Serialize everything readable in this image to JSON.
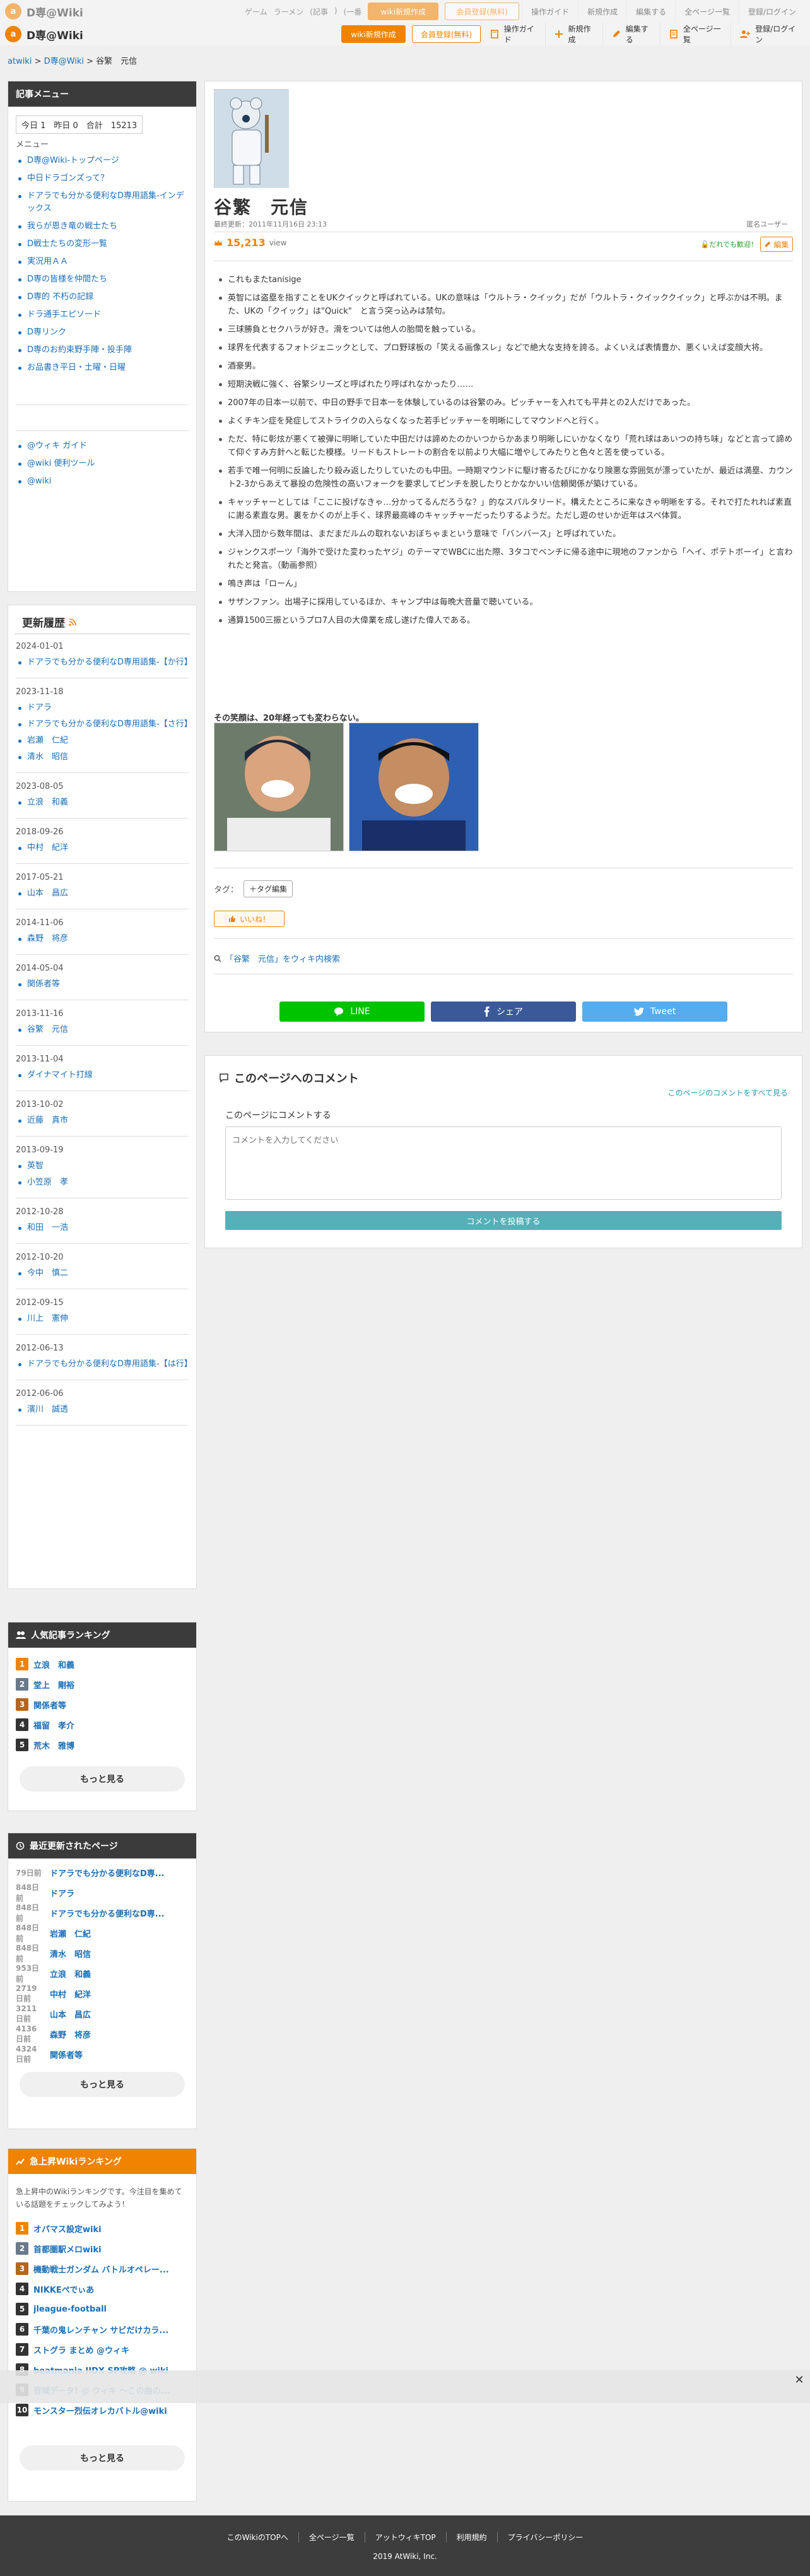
{
  "site": {
    "name": "D専@Wiki",
    "logo_char": "a",
    "btn_wiki_new": "wiki新規作成",
    "btn_member": "会員登録(無料)",
    "menu": [
      "操作ガイド",
      "新規作成",
      "編集する",
      "全ページ一覧",
      "登録/ログイン"
    ],
    "ghost_menu": [
      "ゲーム",
      "ラーメン",
      "(記事",
      ")",
      "(一番"
    ]
  },
  "breadcrumb": {
    "home": "atwiki",
    "sep1": " > ",
    "site": "D専@Wiki",
    "sep2": " > ",
    "page": "谷繁　元信"
  },
  "sidebar": {
    "title": "記事メニュー",
    "counter": "今日 1　昨日 0　合計　15213",
    "menu_label": "メニュー",
    "links": [
      "D専@Wiki-トップページ",
      "中日ドラゴンズって？",
      "ドアラでも分かる便利なD専用語集-インデックス",
      "我らが恩き竜の戦士たち",
      "D戦士たちの変形一覧",
      "実況用ＡＡ",
      "D専の皆様を仲間たち",
      "D専的 不朽の記録",
      "ドラ通手エピソード",
      "D専リンク",
      "D専のお約束野手陣・投手陣",
      "お品書き平日・土曜・日曜"
    ],
    "tools": [
      "@ウィキ ガイド",
      "@wiki 便利ツール",
      "@wiki"
    ]
  },
  "history": {
    "title": "更新履歴",
    "groups": [
      {
        "date": "2024-01-01",
        "items": [
          "ドアラでも分かる便利なD専用語集-【か行】"
        ]
      },
      {
        "date": "2023-11-18",
        "items": [
          "ドアラ",
          "ドアラでも分かる便利なD専用語集-【さ行】",
          "岩瀬　仁紀",
          "清水　昭信"
        ]
      },
      {
        "date": "2023-08-05",
        "items": [
          "立浪　和義"
        ]
      },
      {
        "date": "2018-09-26",
        "items": [
          "中村　紀洋"
        ]
      },
      {
        "date": "2017-05-21",
        "items": [
          "山本　昌広"
        ]
      },
      {
        "date": "2014-11-06",
        "items": [
          "森野　将彦"
        ]
      },
      {
        "date": "2014-05-04",
        "items": [
          "関係者等"
        ]
      },
      {
        "date": "2013-11-16",
        "items": [
          "谷繁　元信"
        ]
      },
      {
        "date": "2013-11-04",
        "items": [
          "ダイナマイト打線"
        ]
      },
      {
        "date": "2013-10-02",
        "items": [
          "近藤　真市"
        ]
      },
      {
        "date": "2013-09-19",
        "items": [
          "英智",
          "小笠原　孝"
        ]
      },
      {
        "date": "2012-10-28",
        "items": [
          "和田　一浩"
        ]
      },
      {
        "date": "2012-10-20",
        "items": [
          "今中　慎二"
        ]
      },
      {
        "date": "2012-09-15",
        "items": [
          "川上　憲伸"
        ]
      },
      {
        "date": "2012-06-13",
        "items": [
          "ドアラでも分かる便利なD専用語集-【は行】"
        ]
      },
      {
        "date": "2012-06-06",
        "items": [
          "濱川　誠透"
        ]
      }
    ]
  },
  "popular": {
    "title": "人気記事ランキング",
    "items": [
      {
        "n": "1",
        "t": "立浪　和義",
        "c": "#f08300"
      },
      {
        "n": "2",
        "t": "堂上　剛裕",
        "c": "#6a7a8a"
      },
      {
        "n": "3",
        "t": "関係者等",
        "c": "#b5651d"
      },
      {
        "n": "4",
        "t": "福留　孝介",
        "c": "#333333"
      },
      {
        "n": "5",
        "t": "荒木　雅博",
        "c": "#333333"
      }
    ],
    "more": "もっと見る"
  },
  "recent": {
    "title": "最近更新されたページ",
    "items": [
      {
        "ago": "79日前",
        "t": "ドアラでも分かる便利なD専..."
      },
      {
        "ago": "848日前",
        "t": "ドアラ"
      },
      {
        "ago": "848日前",
        "t": "ドアラでも分かる便利なD専..."
      },
      {
        "ago": "848日前",
        "t": "岩瀬　仁紀"
      },
      {
        "ago": "848日前",
        "t": "清水　昭信"
      },
      {
        "ago": "953日前",
        "t": "立浪　和義"
      },
      {
        "ago": "2719日前",
        "t": "中村　紀洋"
      },
      {
        "ago": "3211日前",
        "t": "山本　昌広"
      },
      {
        "ago": "4136日前",
        "t": "森野　将彦"
      },
      {
        "ago": "4324日前",
        "t": "関係者等"
      }
    ],
    "more": "もっと見る"
  },
  "rising": {
    "title": "急上昇Wikiランキング",
    "desc": "急上昇中のWikiランキングです。今注目を集めている話題をチェックしてみよう！",
    "items": [
      {
        "n": "1",
        "t": "オパマス設定wiki",
        "c": "#f08300"
      },
      {
        "n": "2",
        "t": "首都圏駅メロwiki",
        "c": "#6a7a8a"
      },
      {
        "n": "3",
        "t": "機動戦士ガンダム バトルオペレー...",
        "c": "#b5651d"
      },
      {
        "n": "4",
        "t": "NIKKEぺでぃあ",
        "c": "#333333"
      },
      {
        "n": "5",
        "t": "jleague-football",
        "c": "#333333"
      },
      {
        "n": "6",
        "t": "千葉の鬼レンチャン サビだけカラ...",
        "c": "#333333"
      },
      {
        "n": "7",
        "t": "ストグラ まとめ @ウィキ",
        "c": "#333333"
      },
      {
        "n": "8",
        "t": "beatmania IIDX SP攻略 @ wiki",
        "c": "#333333"
      },
      {
        "n": "9",
        "t": "音域データ! @ ウィキ 〜この曲の...",
        "c": "#333333"
      },
      {
        "n": "10",
        "t": "モンスター烈伝オレカバトル@wiki",
        "c": "#333333"
      }
    ],
    "more": "もっと見る"
  },
  "page": {
    "title": "谷繁　元信",
    "updated": "最終更新：2011年11月16日 23:13",
    "author": "匿名ユーザー",
    "views": "15,213",
    "views_unit": "view",
    "edit_ok": "だれでも歓迎！",
    "edit_btn": "編集",
    "bullets": [
      "これもまたtanisige",
      "英智には盗塁を指すことをUKクイックと呼ばれている。UKの意味は「ウルトラ・クイック」だが「ウルトラ・クイッククイック」と呼ぶかは不明。また、UKの「クイック」は\"Quick\"　と言う突っ込みは禁句。",
      "三球勝負とセクハラが好き。滑をついては他人の胎間を触っている。",
      "球界を代表するフォトジェニックとして、プロ野球板の「笑える画像スレ」などで絶大な支持を誇る。よくいえば表情豊か、悪くいえば変顔大将。",
      "酒豪男。",
      "短期決戦に強く、谷繁シリーズと呼ばれたり呼ばれなかったり……",
      "2007年の日本一以前で、中日の野手で日本一を体験しているのは谷繁のみ。ピッチャーを入れても平井との2人だけであった。",
      "よくチキン症を発症してストライクの入らなくなった若手ピッチャーを明晰にしてマウンドへと行く。",
      "ただ、特に彰炫が悪くて被弾に明晰していた中田だけは諦めたのかいつからかあまり明晰しにいかなくなり「荒れ球はあいつの持ち味」などと言って諦めて仰ぐすみ方針へと転じた模様。リードもストレートの割合を以前より大幅に増やしてみたりと色々と苦を使っている。",
      "若手で唯一何明に反論したり殺み返したりしていたのも中田。一時期マウンドに駆け寄るたびにかなり険悪な雰囲気が漂っていたが、最近は満塁、カウント2-3からあえて暴投の危険性の高いフォークを要求してピンチを脱したりとかなかいい信頼関係が築けている。",
      "キャッチャーとしては「ここに投げなきゃ…分かってるんだろうな？」的なスパルタリード。構えたところに来なきゃ明晰をする。それで打たれれば素直に謝る素直な男。裏をかくのが上手く、球界最高峰のキャッチャーだったりするようだ。ただし遊のせいか近年はスペ体質。",
      "大洋入団から数年間は、まだまだルムの取れないおぼちゃまという意味で「バンバース」と呼ばれていた。",
      "ジャンクスポーツ「海外で受けた変わったヤジ」のテーマでWBCに出た際、3タコでベンチに帰る途中に現地のファンから「ヘイ、ポテトボーイ」と言われたと発言。（動画参照）",
      "鳴き声は「ローん」",
      "サザンファン。出場子に採用しているほか、キャンプ中は毎晩大音量で聴いている。",
      "通算1500三振というプロ7人目の大偉業を成し遂げた偉人である。"
    ],
    "caption": "その笑顔は、20年経っても変わらない。",
    "tag_label": "タグ：",
    "tag_edit": "＋タグ編集",
    "like": "いいね！",
    "search_link": "「谷繁　元信」をウィキ内検索",
    "share": {
      "line": "LINE",
      "fb": "シェア",
      "tw": "Tweet"
    }
  },
  "comment": {
    "title": "このページへのコメント",
    "all_link": "このページのコメントをすべて見る",
    "label": "このページにコメントする",
    "placeholder": "コメントを入力してください",
    "post": "コメントを投稿する"
  },
  "footer": {
    "links": [
      "このWikiのTOPへ",
      "全ページ一覧",
      "アットウィキTOP",
      "利用規約",
      "プライバシーポリシー"
    ],
    "copy": "2019 AtWiki, Inc."
  },
  "colors": {
    "accent": "#f08300",
    "link": "#1a6fb5",
    "line": "#00c300",
    "facebook": "#3b5998",
    "twitter": "#55acee"
  }
}
